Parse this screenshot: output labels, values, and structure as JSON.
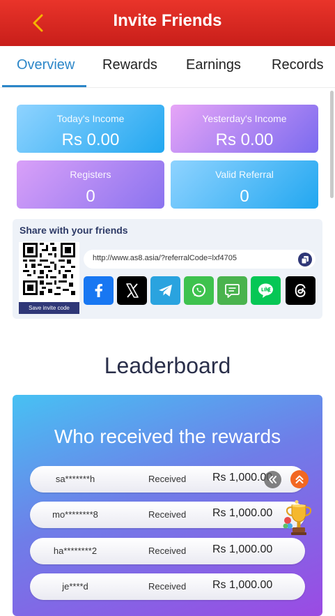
{
  "header": {
    "title": "Invite Friends",
    "back_icon": "chevron-left-icon"
  },
  "tabs": [
    {
      "label": "Overview",
      "active": true
    },
    {
      "label": "Rewards",
      "active": false
    },
    {
      "label": "Earnings",
      "active": false
    },
    {
      "label": "Records",
      "active": false
    }
  ],
  "stats": [
    {
      "label": "Today's Income",
      "value": "Rs 0.00"
    },
    {
      "label": "Yesterday's Income",
      "value": "Rs 0.00"
    },
    {
      "label": "Registers",
      "value": "0"
    },
    {
      "label": "Valid Referral",
      "value": "0"
    }
  ],
  "share": {
    "title": "Share with your friends",
    "save_label": "Save invite code",
    "link": "http://www.as8.asia/?referralCode=lxf4705",
    "social": [
      {
        "name": "facebook-icon",
        "color": "#1877f2"
      },
      {
        "name": "x-icon",
        "color": "#000000"
      },
      {
        "name": "telegram-icon",
        "color": "#2aa3df"
      },
      {
        "name": "whatsapp-icon",
        "color": "#3ec24e"
      },
      {
        "name": "sms-icon",
        "color": "#4ab34e"
      },
      {
        "name": "line-icon",
        "color": "#06c755"
      },
      {
        "name": "threads-icon",
        "color": "#000000"
      }
    ]
  },
  "leaderboard": {
    "title": "Leaderboard",
    "card_title": "Who received the rewards",
    "rows": [
      {
        "name": "sa*******h",
        "status": "Received",
        "amount": "Rs 1,000.00"
      },
      {
        "name": "mo********8",
        "status": "Received",
        "amount": "Rs 1,000.00"
      },
      {
        "name": "ha********2",
        "status": "Received",
        "amount": "Rs 1,000.00"
      },
      {
        "name": "je****d",
        "status": "Received",
        "amount": "Rs 1,000.00"
      }
    ]
  },
  "colors": {
    "header": "#d9271f",
    "accent": "#2b86c8",
    "save_button": "#2f3777",
    "scroll_top": "#f26722"
  }
}
